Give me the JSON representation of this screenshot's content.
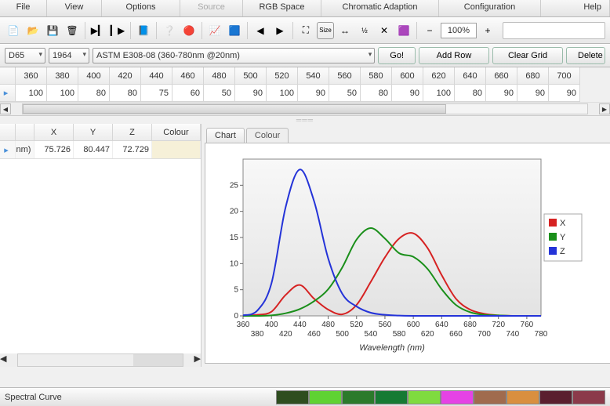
{
  "menu": {
    "items": [
      "File",
      "View",
      "Options",
      "Source",
      "RGB Space",
      "Chromatic Adaption",
      "Configuration",
      "Help"
    ],
    "disabled_index": 3
  },
  "toolbar": {
    "zoom": "100%"
  },
  "controls": {
    "illuminant": "D65",
    "observer": "1964",
    "method": "ASTM E308-08 (360-780nm @20nm)",
    "go": "Go!",
    "add_row": "Add Row",
    "clear_grid": "Clear Grid",
    "delete": "Delete"
  },
  "top_grid": {
    "headers": [
      "360",
      "380",
      "400",
      "420",
      "440",
      "460",
      "480",
      "500",
      "520",
      "540",
      "560",
      "580",
      "600",
      "620",
      "640",
      "660",
      "680",
      "700"
    ],
    "row": [
      "100",
      "100",
      "80",
      "80",
      "75",
      "60",
      "50",
      "90",
      "100",
      "90",
      "50",
      "80",
      "90",
      "100",
      "80",
      "90",
      "90",
      "90"
    ]
  },
  "left_table": {
    "headers": [
      "",
      "",
      "X",
      "Y",
      "Z",
      "Colour"
    ],
    "row": {
      "marker": "▸",
      "label": "nm)",
      "x": "75.726",
      "y": "80.447",
      "z": "72.729",
      "colour": ""
    }
  },
  "tabs": {
    "chart": "Chart",
    "colour": "Colour",
    "active": "chart"
  },
  "status_text": "Spectral Curve",
  "swatches": [
    "#2e4d1f",
    "#5fd232",
    "#2b7a2b",
    "#167a33",
    "#7fdb3f",
    "#e543e5",
    "#a06b4e",
    "#d98f3f",
    "#5a1f2e",
    "#8b3a4a"
  ],
  "chart_data": {
    "type": "line",
    "title": "",
    "xlabel": "Wavelength (nm)",
    "ylabel": "",
    "xlim": [
      360,
      780
    ],
    "ylim": [
      0,
      30
    ],
    "xticks_top": [
      360,
      400,
      440,
      480,
      520,
      560,
      600,
      640,
      680,
      720,
      760
    ],
    "xticks_bottom": [
      380,
      420,
      460,
      500,
      540,
      580,
      620,
      660,
      700,
      740,
      780
    ],
    "yticks": [
      0,
      5,
      10,
      15,
      20,
      25
    ],
    "series": [
      {
        "name": "X",
        "color": "#d62222",
        "x": [
          360,
          380,
          400,
          420,
          440,
          460,
          480,
          500,
          520,
          540,
          560,
          580,
          600,
          620,
          640,
          660,
          680,
          700,
          720,
          740,
          760,
          780
        ],
        "y": [
          0,
          0.2,
          0.8,
          4.0,
          5.9,
          3.3,
          1.2,
          0.3,
          2.1,
          6.5,
          11.2,
          14.8,
          15.8,
          13.0,
          7.8,
          3.3,
          1.2,
          0.4,
          0.1,
          0,
          0,
          0
        ]
      },
      {
        "name": "Y",
        "color": "#1a8f1a",
        "x": [
          360,
          380,
          400,
          420,
          440,
          460,
          480,
          500,
          520,
          540,
          560,
          580,
          600,
          620,
          640,
          660,
          680,
          700,
          720,
          740,
          760,
          780
        ],
        "y": [
          0,
          0,
          0.1,
          0.5,
          1.3,
          2.8,
          5.1,
          9.3,
          14.6,
          16.8,
          14.8,
          12.0,
          11.3,
          9.0,
          5.1,
          2.1,
          0.7,
          0.2,
          0.1,
          0,
          0,
          0
        ]
      },
      {
        "name": "Z",
        "color": "#2433d8",
        "x": [
          360,
          380,
          400,
          420,
          440,
          460,
          480,
          500,
          520,
          540,
          560,
          580,
          600,
          620,
          640,
          660,
          680,
          700,
          720,
          740,
          760,
          780
        ],
        "y": [
          0.1,
          1.0,
          6.2,
          20.8,
          28.0,
          22.0,
          11.0,
          4.2,
          1.8,
          0.6,
          0.2,
          0.05,
          0,
          0,
          0,
          0,
          0,
          0,
          0,
          0,
          0,
          0
        ]
      }
    ]
  }
}
